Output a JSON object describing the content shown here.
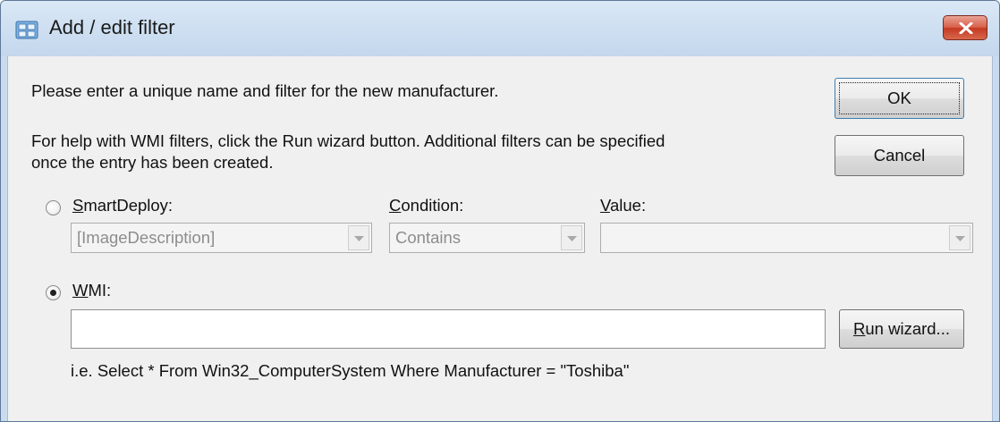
{
  "window": {
    "title": "Add / edit filter",
    "title_icon": "filter-app-icon",
    "close_icon": "close-icon"
  },
  "instructions": {
    "line1": "Please enter a unique name and filter for the new manufacturer.",
    "line2": "For help with WMI filters, click the Run wizard button. Additional filters can be specified",
    "line3": "once the entry has been created."
  },
  "buttons": {
    "ok_label": "OK",
    "cancel_label": "Cancel",
    "run_wizard_label_first": "R",
    "run_wizard_label_rest": "un wizard..."
  },
  "smartdeploy": {
    "label_first": "S",
    "label_rest": "martDeploy:",
    "selected": false,
    "value": "[ImageDescription]"
  },
  "condition": {
    "label_first": "C",
    "label_rest": "ondition:",
    "value": "Contains"
  },
  "value_field": {
    "label_first": "V",
    "label_rest": "alue:",
    "value": ""
  },
  "wmi": {
    "label_first": "W",
    "label_rest": "MI:",
    "selected": true,
    "query": "",
    "example": "i.e. Select * From Win32_ComputerSystem Where Manufacturer = \"Toshiba\""
  }
}
